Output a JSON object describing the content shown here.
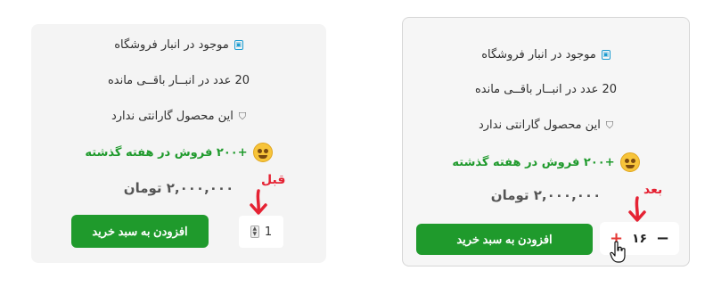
{
  "before": {
    "annotation": "قبل",
    "stock_label": "موجود در انبار فروشگاه",
    "remaining_label": "20 عدد در انبــار باقــی مانده",
    "warranty_label": "این محصول گارانتی ندارد",
    "sales_label": "+۲۰۰ فروش در هفته گذشته",
    "price_label": "۲,۰۰۰,۰۰۰ تومان",
    "add_to_cart_label": "افزودن به سبد خرید",
    "quantity_value": "1"
  },
  "after": {
    "annotation": "بعد",
    "stock_label": "موجود در انبار فروشگاه",
    "remaining_label": "20 عدد در انبــار باقــی مانده",
    "warranty_label": "این محصول گارانتی ندارد",
    "sales_label": "+۲۰۰ فروش در هفته گذشته",
    "price_label": "۲,۰۰۰,۰۰۰ تومان",
    "add_to_cart_label": "افزودن به سبد خرید",
    "quantity_value": "۱۶",
    "plus_label": "+",
    "minus_label": "−"
  },
  "icons": {
    "stock": "store-icon",
    "warranty": "shield-icon",
    "sales": "star-struck-emoji-icon",
    "arrow": "red-down-arrow-icon",
    "cursor": "hand-pointer-icon",
    "spinner": "number-spinner-icon"
  },
  "colors": {
    "accent_green": "#1f9a2c",
    "annotation_red": "#e52233",
    "stock_blue": "#1a9bd0"
  }
}
